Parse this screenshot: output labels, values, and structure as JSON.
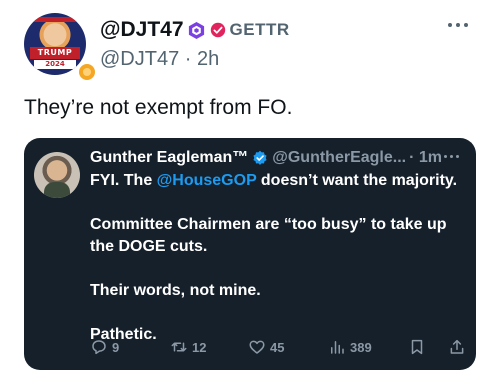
{
  "author": {
    "handle": "@DJT47",
    "platform_label": "GETTR",
    "username": "@DJT47",
    "time": "2h",
    "avatar_text_top": "TRUMP",
    "avatar_text_bottom": "2024"
  },
  "post": {
    "text": "They’re not exempt from FO."
  },
  "quoted": {
    "name": "Gunther Eagleman™",
    "handle": "@GuntherEagle...",
    "time": "· 1m",
    "line1_prefix": "FYI.  The ",
    "line1_mention": "@HouseGOP",
    "line1_suffix": " doesn’t want the majority.",
    "paragraph2": "Committee Chairmen are “too busy” to take up the DOGE cuts.",
    "paragraph3": "Their words, not mine.",
    "paragraph4": "Pathetic.",
    "stats": {
      "replies": "9",
      "reposts": "12",
      "likes": "45",
      "views": "389"
    }
  },
  "icons": {
    "more": "more-dots-icon",
    "verified": "verified-badge-icon",
    "reply": "reply-icon",
    "repost": "repost-icon",
    "like": "heart-icon",
    "views": "views-icon",
    "bookmark": "bookmark-icon",
    "share": "share-icon"
  },
  "colors": {
    "link": "#1d9bf0",
    "card_bg": "#15202b",
    "muted": "#536471",
    "gettr_red": "#e0245e",
    "badge_purple": "#7b3fe4"
  }
}
